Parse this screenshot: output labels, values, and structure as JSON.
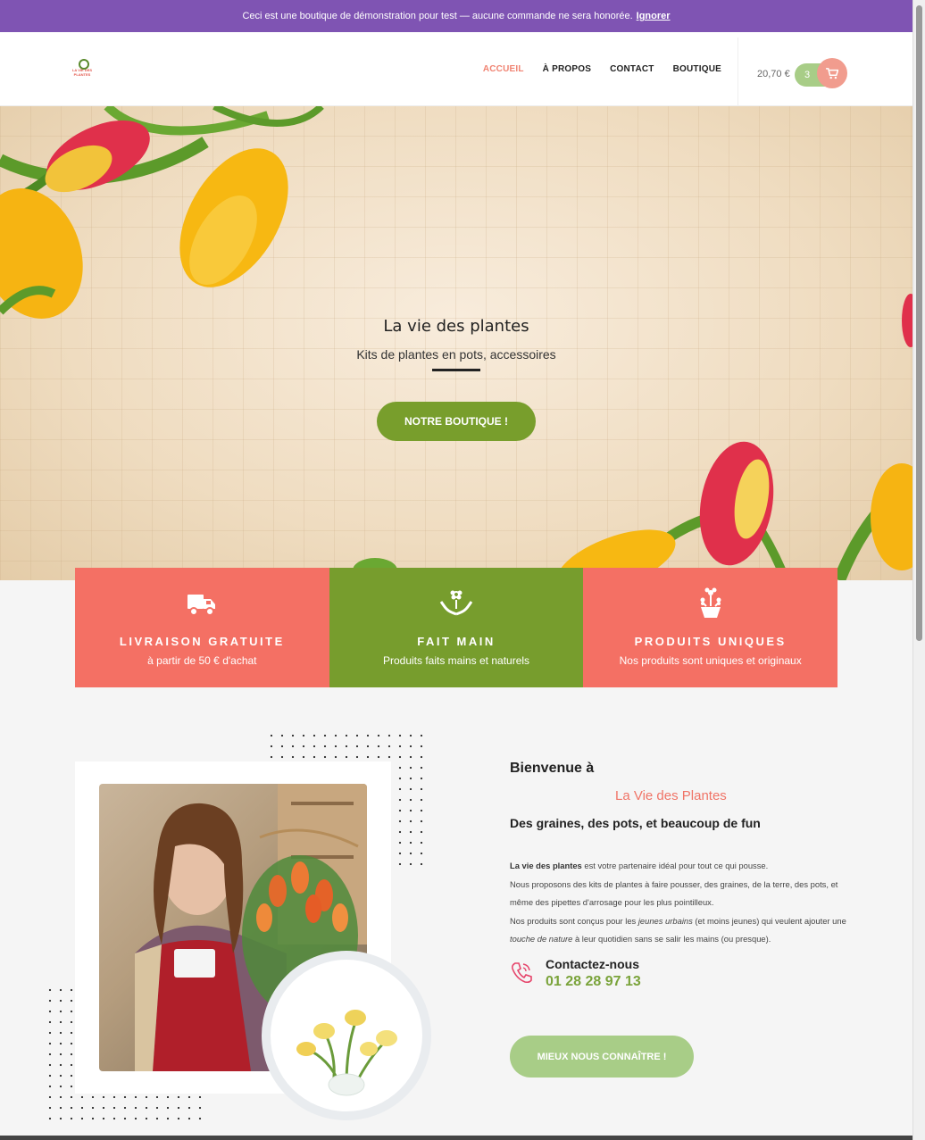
{
  "notice": {
    "text": "Ceci est une boutique de démonstration pour test — aucune commande ne sera honorée.",
    "dismiss": "Ignorer"
  },
  "header": {
    "logo_text": "LA VIE DES PLANTES",
    "nav": [
      {
        "label": "ACCUEIL",
        "active": true
      },
      {
        "label": "À PROPOS",
        "active": false
      },
      {
        "label": "CONTACT",
        "active": false
      },
      {
        "label": "BOUTIQUE",
        "active": false
      }
    ],
    "cart_total": "20,70 €",
    "cart_count": "3",
    "cart_icon": "shopping-cart-icon"
  },
  "hero": {
    "title": "La vie des plantes",
    "subtitle": "Kits de plantes en pots, accessoires",
    "button": "NOTRE BOUTIQUE !"
  },
  "features": [
    {
      "icon": "truck-icon",
      "title": "LIVRAISON GRATUITE",
      "desc": "à partir de 50 € d'achat",
      "color": "#f47064"
    },
    {
      "icon": "hands-flower-icon",
      "title": "FAIT MAIN",
      "desc": "Produits faits mains et naturels",
      "color": "#779d2d"
    },
    {
      "icon": "flower-pot-icon",
      "title": "PRODUITS UNIQUES",
      "desc": "Nos produits sont uniques et originaux",
      "color": "#f47064"
    }
  ],
  "about": {
    "welcome": "Bienvenue à",
    "brand": "La Vie des Plantes",
    "tagline": "Des graines, des pots, et beaucoup de fun",
    "p1_bold": "La vie des plantes",
    "p1_rest": " est votre partenaire idéal pour tout ce qui pousse.",
    "p2": "Nous proposons des kits de plantes à faire pousser, des graines, de la terre, des pots, et même des pipettes d'arrosage pour les plus pointilleux.",
    "p3_a": "Nos produits sont conçus pour les ",
    "p3_em1": "jeunes urbains",
    "p3_b": " (et moins jeunes) qui veulent ajouter une ",
    "p3_em2": "touche de nature",
    "p3_c": " à leur quotidien sans se salir les mains (ou presque).",
    "contact_title": "Contactez-nous",
    "contact_phone": "01 28 28 97 13",
    "button": "MIEUX NOUS CONNAÎTRE !"
  },
  "colors": {
    "accent_green": "#779d2d",
    "accent_coral": "#f47064",
    "notice_purple": "#7f54b3",
    "light_green": "#a8cd87"
  }
}
